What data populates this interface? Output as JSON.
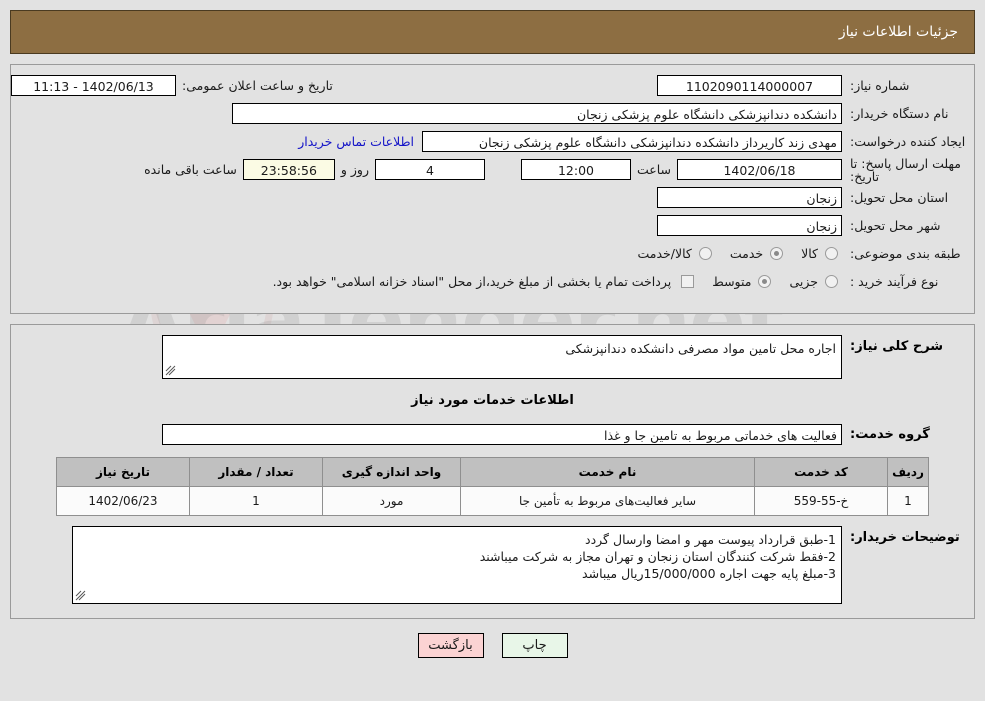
{
  "header": {
    "title": "جزئیات اطلاعات نیاز"
  },
  "top": {
    "need_number_label": "شماره نیاز:",
    "need_number_value": "1102090114000007",
    "announce_label": "تاریخ و ساعت اعلان عمومی:",
    "announce_value": "1402/06/13 - 11:13",
    "buyer_org_label": "نام دستگاه خریدار:",
    "buyer_org_value": "دانشکده دندانپزشکی دانشگاه علوم پزشکی زنجان",
    "creator_label": "ایجاد کننده درخواست:",
    "creator_value": "مهدی زند کاریرداز دانشکده دندانپزشکی دانشگاه علوم پزشکی زنجان",
    "contact_link": "اطلاعات تماس خریدار",
    "deadline_label": "مهلت ارسال پاسخ: تا تاریخ:",
    "deadline_date": "1402/06/18",
    "hour_label": "ساعت",
    "deadline_time": "12:00",
    "days_value": "4",
    "days_word": "روز و",
    "timer_value": "23:58:56",
    "remaining_word": "ساعت باقی مانده",
    "province_label": "استان محل تحویل:",
    "province_value": "زنجان",
    "city_label": "شهر محل تحویل:",
    "city_value": "زنجان",
    "category_label": "طبقه بندی موضوعی:",
    "category_options": [
      {
        "label": "کالا",
        "checked": false
      },
      {
        "label": "خدمت",
        "checked": true
      },
      {
        "label": "کالا/خدمت",
        "checked": false
      }
    ],
    "process_label": "نوع فرآیند خرید :",
    "process_options": [
      {
        "label": "جزیی",
        "checked": false
      },
      {
        "label": "متوسط",
        "checked": true
      }
    ],
    "treasury_note": "پرداخت تمام یا بخشی از مبلغ خرید،از محل \"اسناد خزانه اسلامی\" خواهد بود."
  },
  "mid": {
    "desc_label": "شرح کلی نیاز:",
    "desc_value": "اجاره محل تامین مواد مصرفی دانشکده دندانپزشکی",
    "section_title": "اطلاعات خدمات مورد نیاز",
    "service_group_label": "گروه خدمت:",
    "service_group_value": "فعالیت های خدماتی مربوط به تامین جا و غذا",
    "table": {
      "columns": [
        "ردیف",
        "کد خدمت",
        "نام خدمت",
        "واحد اندازه گیری",
        "تعداد / مقدار",
        "تاریخ نیاز"
      ],
      "rows": [
        {
          "radif": "1",
          "code": "خ-55-559",
          "name": "سایر فعالیت‌های مربوط به تأمین جا",
          "unit": "مورد",
          "qty": "1",
          "date": "1402/06/23"
        }
      ]
    },
    "notes_label": "توضیحات خریدار:",
    "notes_value": "1-طبق قرارداد پیوست مهر و امضا وارسال گردد\n2-فقط شرکت کنندگان استان زنجان و تهران مجاز به شرکت میباشند\n3-مبلغ پایه جهت اجاره 15/000/000ریال میباشد"
  },
  "footer": {
    "print_label": "چاپ",
    "back_label": "بازگشت"
  },
  "watermark": {
    "text": "AriaTender.net"
  },
  "colors": {
    "header_bg": "#8d6e42",
    "link": "#1414c8",
    "timer_bg": "#fbfbe4",
    "table_header_bg": "#c0c0c0",
    "print_btn_bg": "#e8f6e8",
    "back_btn_bg": "#fbd3d3"
  }
}
